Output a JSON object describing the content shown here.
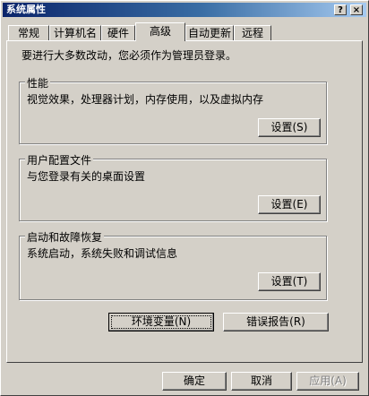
{
  "window": {
    "title": "系统属性",
    "help_button": "?",
    "close_button": "×"
  },
  "tabs": [
    {
      "label": "常规"
    },
    {
      "label": "计算机名"
    },
    {
      "label": "硬件"
    },
    {
      "label": "高级"
    },
    {
      "label": "自动更新"
    },
    {
      "label": "远程"
    }
  ],
  "notice": "要进行大多数改动，您必须作为管理员登录。",
  "groups": {
    "performance": {
      "title": "性能",
      "description": "视觉效果，处理器计划，内存使用，以及虚拟内存",
      "button": "设置(S)"
    },
    "user_profiles": {
      "title": "用户配置文件",
      "description": "与您登录有关的桌面设置",
      "button": "设置(E)"
    },
    "startup_recovery": {
      "title": "启动和故障恢复",
      "description": "系统启动，系统失败和调试信息",
      "button": "设置(T)"
    }
  },
  "actions": {
    "env_vars": "环境变量(N)",
    "error_report": "错误报告(R)"
  },
  "footer": {
    "ok": "确定",
    "cancel": "取消",
    "apply": "应用(A)"
  }
}
